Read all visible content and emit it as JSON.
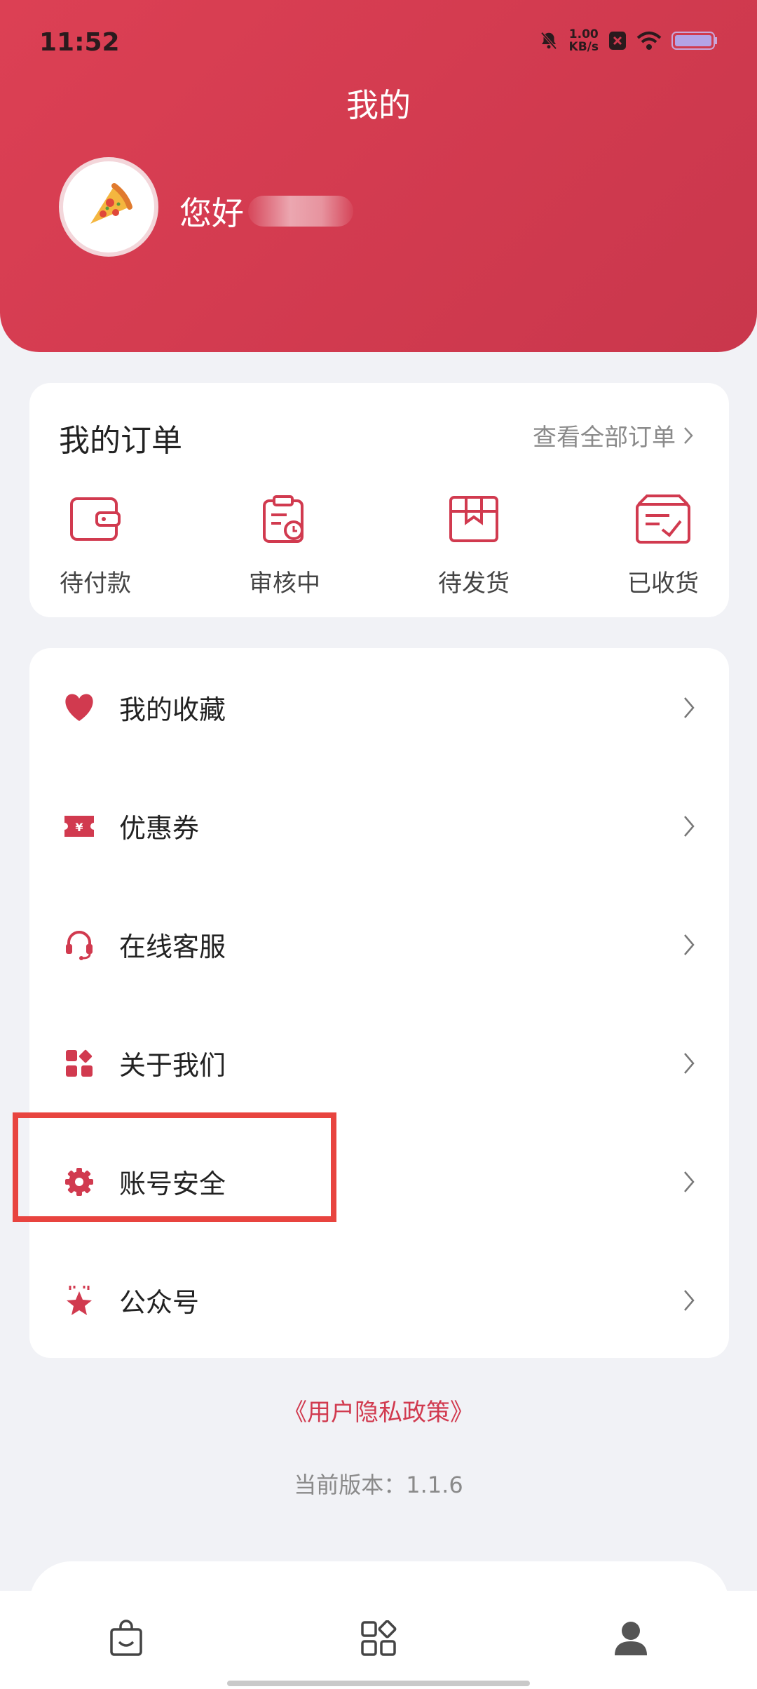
{
  "status_bar": {
    "time": "11:52",
    "net_speed_value": "1.00",
    "net_speed_unit": "KB/s"
  },
  "header": {
    "title": "我的",
    "greeting": "您好"
  },
  "orders": {
    "title": "我的订单",
    "view_all": "查看全部订单",
    "items": [
      {
        "label": "待付款",
        "icon": "wallet-icon"
      },
      {
        "label": "审核中",
        "icon": "clipboard-clock-icon"
      },
      {
        "label": "待发货",
        "icon": "package-icon"
      },
      {
        "label": "已收货",
        "icon": "received-box-icon"
      }
    ]
  },
  "menu": {
    "items": [
      {
        "label": "我的收藏",
        "icon": "heart-icon"
      },
      {
        "label": "优惠券",
        "icon": "coupon-icon"
      },
      {
        "label": "在线客服",
        "icon": "headset-icon"
      },
      {
        "label": "关于我们",
        "icon": "apps-icon"
      },
      {
        "label": "账号安全",
        "icon": "gear-icon"
      },
      {
        "label": "公众号",
        "icon": "star-badge-icon"
      }
    ]
  },
  "footer": {
    "privacy": "《用户隐私政策》",
    "version": "当前版本：1.1.6"
  },
  "tabbar": {
    "tabs": [
      {
        "icon": "shopping-bag-icon"
      },
      {
        "icon": "category-icon"
      },
      {
        "icon": "user-icon"
      }
    ]
  },
  "colors": {
    "brand": "#d13a4f",
    "background": "#f1f2f6",
    "highlight": "#e8443f"
  }
}
